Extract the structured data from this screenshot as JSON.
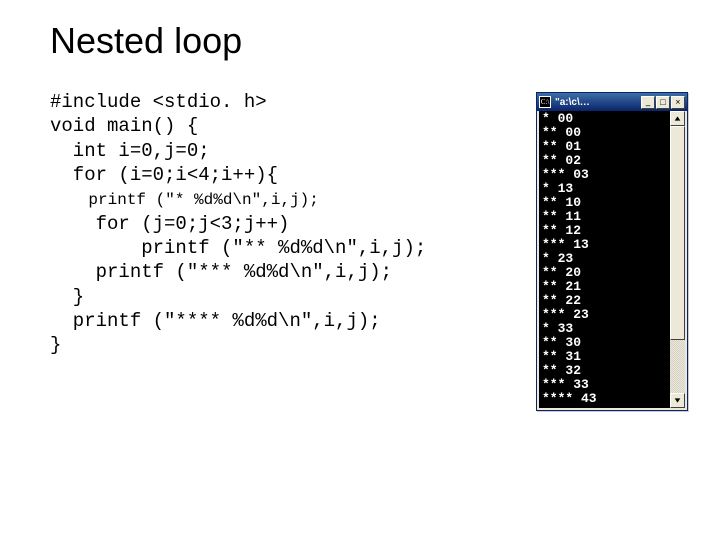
{
  "title": "Nested loop",
  "code": {
    "l1": "#include <stdio. h>",
    "l2": "void main() {",
    "l3": "  int i=0,j=0;",
    "l4": "  for (i=0;i<4;i++){",
    "l5": "    printf (\"* %d%d\\n\",i,j);",
    "l6": "    for (j=0;j<3;j++)",
    "l7": "        printf (\"** %d%d\\n\",i,j);",
    "l8": "    printf (\"*** %d%d\\n\",i,j);",
    "l9": "  }",
    "l10": "  printf (\"**** %d%d\\n\",i,j);",
    "l11": "}"
  },
  "console": {
    "icon_label": "C:\\",
    "title": "\"a:\\c\\…",
    "btn_min": "_",
    "btn_max": "□",
    "btn_close": "×",
    "output": "* 00\n** 00\n** 01\n** 02\n*** 03\n* 13\n** 10\n** 11\n** 12\n*** 13\n* 23\n** 20\n** 21\n** 22\n*** 23\n* 33\n** 30\n** 31\n** 32\n*** 33\n**** 43"
  }
}
